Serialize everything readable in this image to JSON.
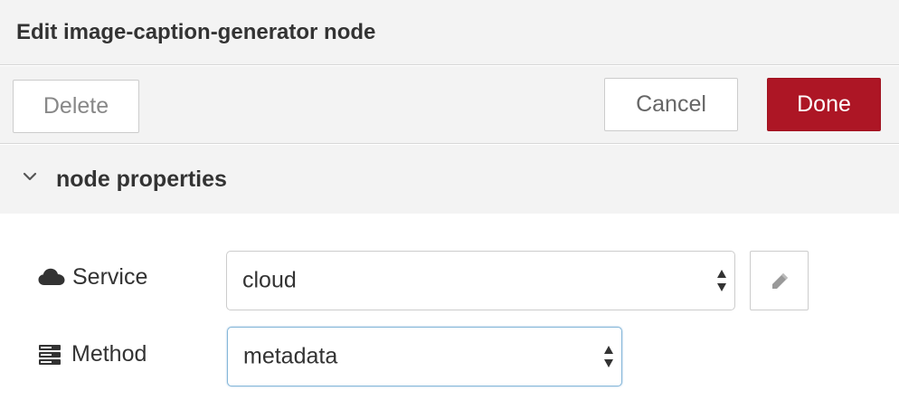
{
  "tray": {
    "title": "Edit image-caption-generator node"
  },
  "toolbar": {
    "delete_label": "Delete",
    "cancel_label": "Cancel",
    "done_label": "Done"
  },
  "section": {
    "title": "node properties",
    "expanded": true
  },
  "form": {
    "service": {
      "label": "Service",
      "icon": "cloud-icon",
      "value": "cloud"
    },
    "method": {
      "label": "Method",
      "icon": "server-icon",
      "value": "metadata"
    },
    "edit_icon": "pencil-icon"
  },
  "colors": {
    "done_button": "#ad1625",
    "header_bg": "#f3f3f3",
    "focus_border": "#85b7d9"
  }
}
